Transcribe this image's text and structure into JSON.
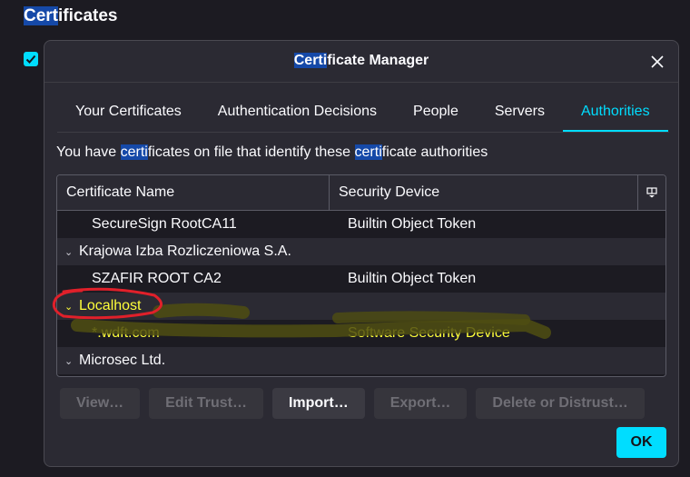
{
  "background": {
    "section_title_hl": "Cert",
    "section_title_rest": "ificates",
    "checkbox_checked": true
  },
  "dialog": {
    "title_hl": "Certi",
    "title_rest": "ficate Manager",
    "close_icon": "close-icon",
    "tabs": [
      {
        "label": "Your Certificates",
        "selected": false
      },
      {
        "label": "Authentication Decisions",
        "selected": false
      },
      {
        "label": "People",
        "selected": false
      },
      {
        "label": "Servers",
        "selected": false
      },
      {
        "label": "Authorities",
        "selected": true
      }
    ],
    "description": {
      "p1": "You have ",
      "hl1": "certi",
      "p2": "ficates on file that identify these ",
      "hl2": "certi",
      "p3": "ficate authorities"
    },
    "table": {
      "columns": [
        "Certificate Name",
        "Security Device"
      ],
      "column_picker_icon": "column-picker-icon",
      "rows": [
        {
          "type": "cert",
          "name": "SecureSign RootCA11",
          "device": "Builtin Object Token"
        },
        {
          "type": "group",
          "name": "Krajowa Izba Rozliczeniowa S.A.",
          "expanded": true
        },
        {
          "type": "cert",
          "name": "SZAFIR ROOT CA2",
          "device": "Builtin Object Token"
        },
        {
          "type": "group",
          "name": "Localhost",
          "expanded": true,
          "highlighted": true
        },
        {
          "type": "cert",
          "name": "*.wdft.com",
          "device": "Software Security Device",
          "highlighted": true
        },
        {
          "type": "group",
          "name": "Microsec Ltd.",
          "expanded": true
        }
      ]
    },
    "buttons": {
      "view": "View…",
      "edit_trust": "Edit Trust…",
      "import": "Import…",
      "export": "Export…",
      "delete": "Delete or Distrust…"
    },
    "ok": "OK"
  },
  "colors": {
    "accent": "#00ddff",
    "highlight_text": "#ffff3a",
    "annotation_red": "#e0202a",
    "marker_yellow": "#4f4d12"
  }
}
